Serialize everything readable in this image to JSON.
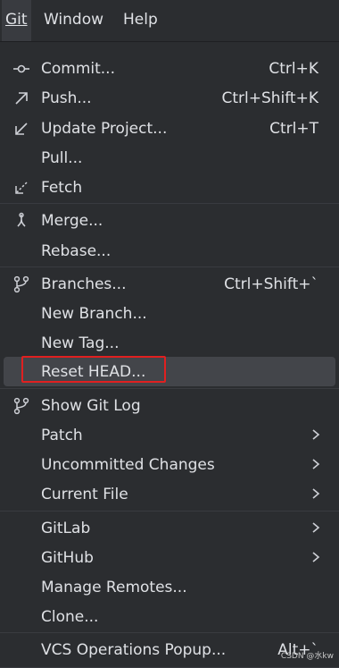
{
  "menubar": {
    "items": [
      {
        "label": "Git"
      },
      {
        "label": "Window"
      },
      {
        "label": "Help"
      }
    ]
  },
  "menu": {
    "commit": {
      "label": "Commit...",
      "shortcut": "Ctrl+K",
      "icon": "commit-icon"
    },
    "push": {
      "label": "Push...",
      "shortcut": "Ctrl+Shift+K",
      "icon": "push-arrow-icon"
    },
    "update_project": {
      "label": "Update Project...",
      "shortcut": "Ctrl+T",
      "icon": "update-arrow-icon"
    },
    "pull": {
      "label": "Pull..."
    },
    "fetch": {
      "label": "Fetch",
      "icon": "fetch-icon"
    },
    "merge": {
      "label": "Merge...",
      "icon": "merge-icon"
    },
    "rebase": {
      "label": "Rebase..."
    },
    "branches": {
      "label": "Branches...",
      "shortcut": "Ctrl+Shift+`",
      "icon": "branch-icon"
    },
    "new_branch": {
      "label": "New Branch..."
    },
    "new_tag": {
      "label": "New Tag..."
    },
    "reset_head": {
      "label": "Reset HEAD...",
      "selected": true
    },
    "show_git_log": {
      "label": "Show Git Log",
      "icon": "git-log-icon"
    },
    "patch": {
      "label": "Patch",
      "submenu": true
    },
    "uncommitted_changes": {
      "label": "Uncommitted Changes",
      "submenu": true
    },
    "current_file": {
      "label": "Current File",
      "submenu": true
    },
    "gitlab": {
      "label": "GitLab",
      "submenu": true
    },
    "github": {
      "label": "GitHub",
      "submenu": true
    },
    "manage_remotes": {
      "label": "Manage Remotes..."
    },
    "clone": {
      "label": "Clone..."
    },
    "vcs_operations_popup": {
      "label": "VCS Operations Popup...",
      "shortcut": "Alt+`"
    }
  },
  "watermark": "CSDN @水kw",
  "colors": {
    "background": "#2b2d30",
    "selection": "#43454a",
    "annotation": "#e02020",
    "text": "#dfe1e5"
  }
}
